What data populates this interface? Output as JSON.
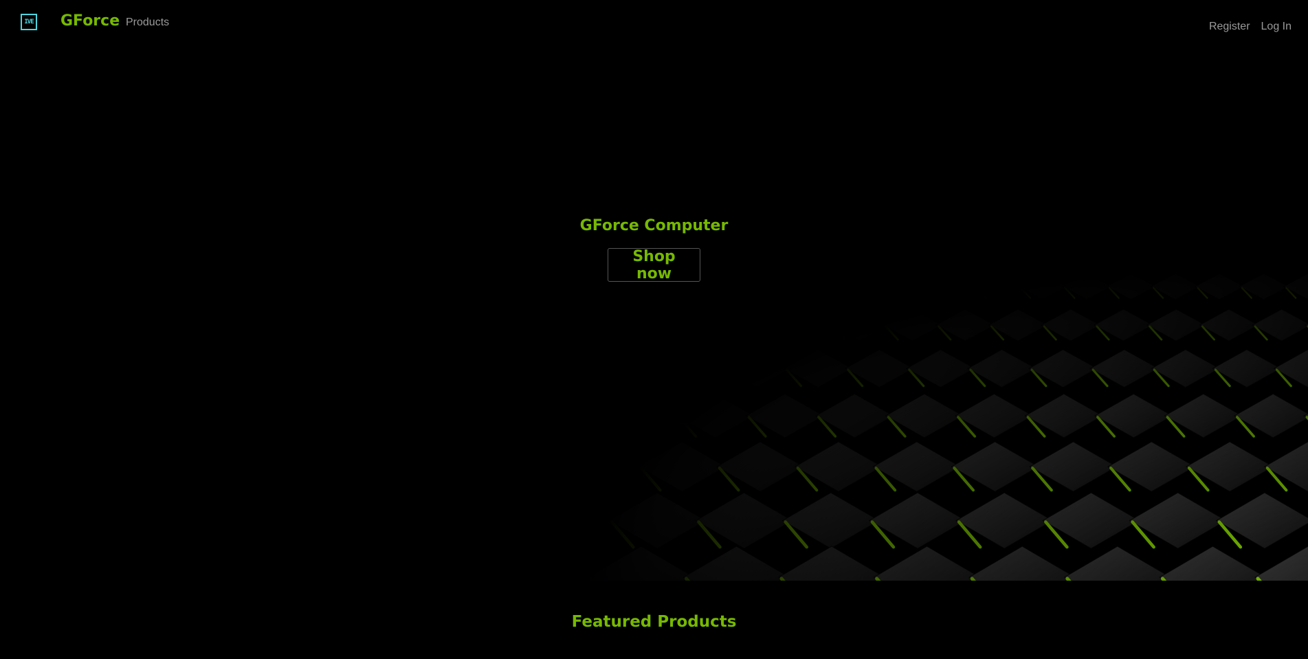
{
  "nav": {
    "logo_text": "IVE",
    "brand": "GForce",
    "products_link": "Products",
    "register_link": "Register",
    "login_link": "Log In"
  },
  "hero": {
    "title": "GForce Computer",
    "cta_label": "Shop now"
  },
  "featured": {
    "title": "Featured Products"
  },
  "colors": {
    "accent": "#76b900",
    "logo": "#4dd6e0",
    "nav_text": "#9a9a9a",
    "background": "#000000"
  }
}
